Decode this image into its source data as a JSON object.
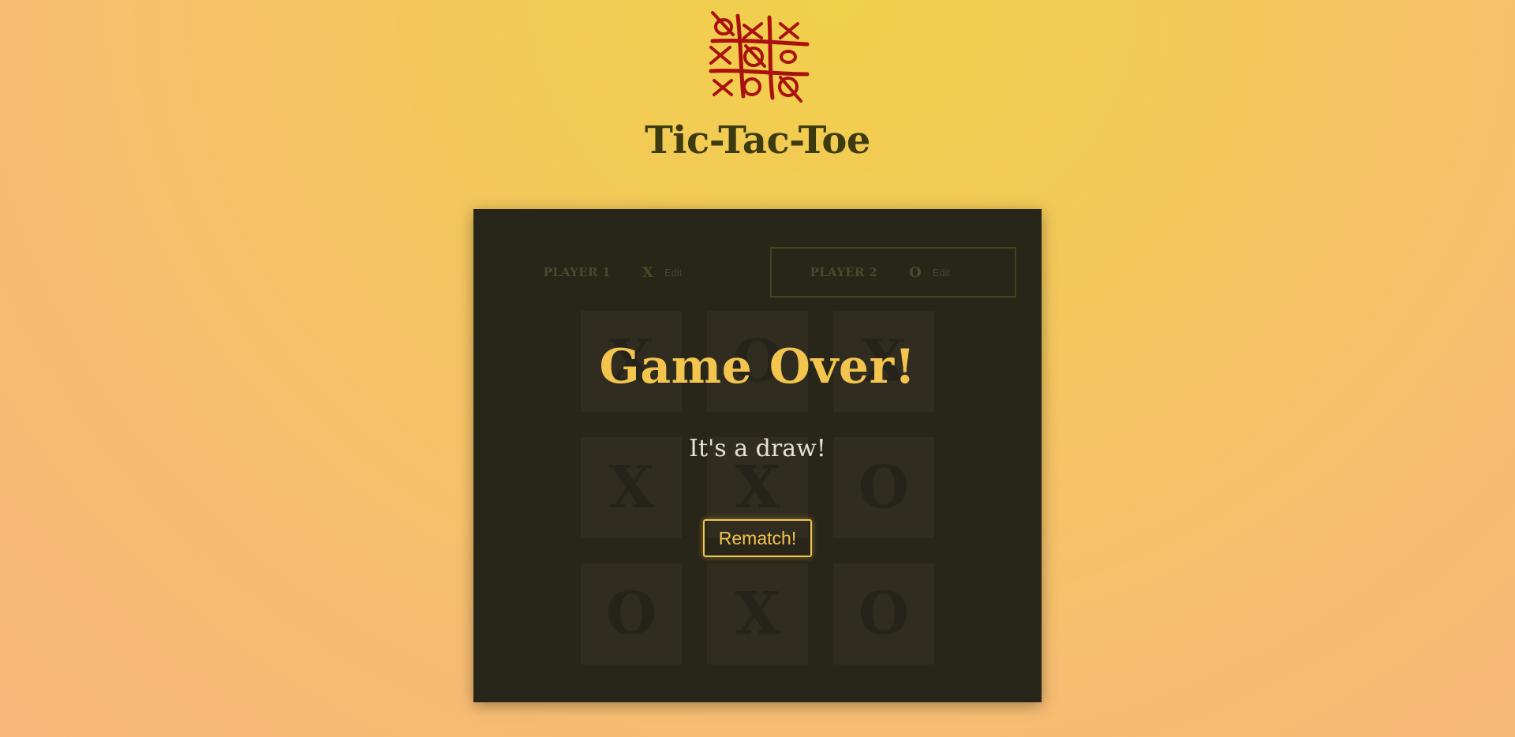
{
  "header": {
    "title": "Tic-Tac-Toe",
    "logo_icon": "tic-tac-toe-logo-icon"
  },
  "players": [
    {
      "name": "PLAYER 1",
      "symbol": "X",
      "edit_label": "Edit",
      "active": false
    },
    {
      "name": "PLAYER 2",
      "symbol": "O",
      "edit_label": "Edit",
      "active": true
    }
  ],
  "board": {
    "cells": [
      "X",
      "O",
      "X",
      "X",
      "X",
      "O",
      "O",
      "X",
      "O"
    ]
  },
  "overlay": {
    "title": "Game Over!",
    "message": "It's a draw!",
    "rematch_label": "Rematch!"
  },
  "colors": {
    "accent": "#f3c44e",
    "panel": "#282519",
    "logo": "#a8110d",
    "title": "#3c3a0e"
  }
}
